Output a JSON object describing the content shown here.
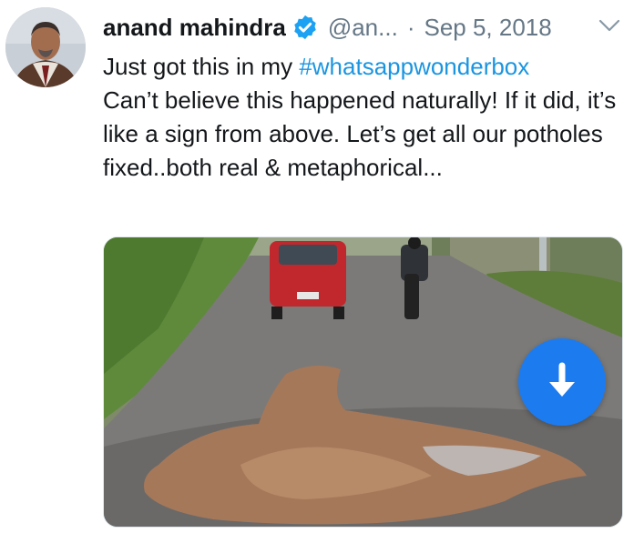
{
  "tweet": {
    "author_name": "anand mahindra",
    "handle": "@an...",
    "separator": "·",
    "date": "Sep 5, 2018",
    "text_before_hashtag": "Just got this in my ",
    "hashtag": "#whatsappwonderbox",
    "text_after": "Can’t believe this happened naturally!  If it did, it’s like a sign from above. Let’s get all our potholes fixed..both real & metaphorical...",
    "icons": {
      "verified": "verified-badge-icon",
      "menu": "chevron-down-icon",
      "download": "download-arrow-icon"
    }
  },
  "colors": {
    "verified_blue": "#1da1f2",
    "hashtag_blue": "#1b95e0",
    "download_button": "#1d7bf0",
    "muted_text": "#657786"
  }
}
